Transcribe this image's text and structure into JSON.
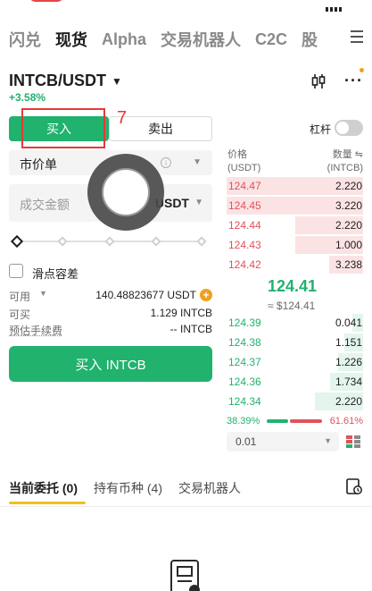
{
  "nav": {
    "tabs": [
      {
        "label": "闪兑",
        "active": false
      },
      {
        "label": "现货",
        "active": true
      },
      {
        "label": "Alpha",
        "active": false
      },
      {
        "label": "交易机器人",
        "active": false
      },
      {
        "label": "C2C",
        "active": false
      },
      {
        "label": "股",
        "active": false
      }
    ]
  },
  "pair": {
    "symbol": "INTCB/USDT",
    "change": "+3.58%"
  },
  "trade": {
    "buy_label": "买入",
    "sell_label": "卖出",
    "annotation_number": "7",
    "leverage_label": "杠杆",
    "leverage_on": false,
    "order_type": "市价单",
    "amount_placeholder": "成交金额",
    "amount_unit": "USDT",
    "slider_percent": 0,
    "slippage_label": "滑点容差",
    "available_label": "可用",
    "available_value": "140.48823677 USDT",
    "can_buy_label": "可买",
    "can_buy_value": "1.129 INTCB",
    "fee_label": "预估手续费",
    "fee_value": "-- INTCB",
    "submit_label": "买入 INTCB"
  },
  "orderbook": {
    "price_header": "价格",
    "price_unit": "(USDT)",
    "qty_header": "数量 ⇋",
    "qty_unit": "(INTCB)",
    "asks": [
      {
        "price": "124.47",
        "qty": "2.220",
        "depth": 1.0
      },
      {
        "price": "124.45",
        "qty": "3.220",
        "depth": 1.0
      },
      {
        "price": "124.44",
        "qty": "2.220",
        "depth": 0.5
      },
      {
        "price": "124.43",
        "qty": "1.000",
        "depth": 0.5
      },
      {
        "price": "124.42",
        "qty": "3.238",
        "depth": 0.25
      }
    ],
    "last_price": "124.41",
    "last_price_usd": "≈ $124.41",
    "bids": [
      {
        "price": "124.39",
        "qty": "0.041",
        "depth": 0.08
      },
      {
        "price": "124.38",
        "qty": "1.151",
        "depth": 0.14
      },
      {
        "price": "124.37",
        "qty": "1.226",
        "depth": 0.18
      },
      {
        "price": "124.36",
        "qty": "1.734",
        "depth": 0.24
      },
      {
        "price": "124.34",
        "qty": "2.220",
        "depth": 0.35
      }
    ],
    "buy_ratio": "38.39%",
    "sell_ratio": "61.61%",
    "depth_step": "0.01"
  },
  "orders": {
    "tabs": [
      {
        "label": "当前委托 (0)",
        "active": true
      },
      {
        "label": "持有币种 (4)",
        "active": false
      },
      {
        "label": "交易机器人",
        "active": false
      }
    ]
  },
  "colors": {
    "buy": "#21b26e",
    "sell": "#e0525a",
    "accent": "#f0c020",
    "annotation": "#e53935"
  }
}
